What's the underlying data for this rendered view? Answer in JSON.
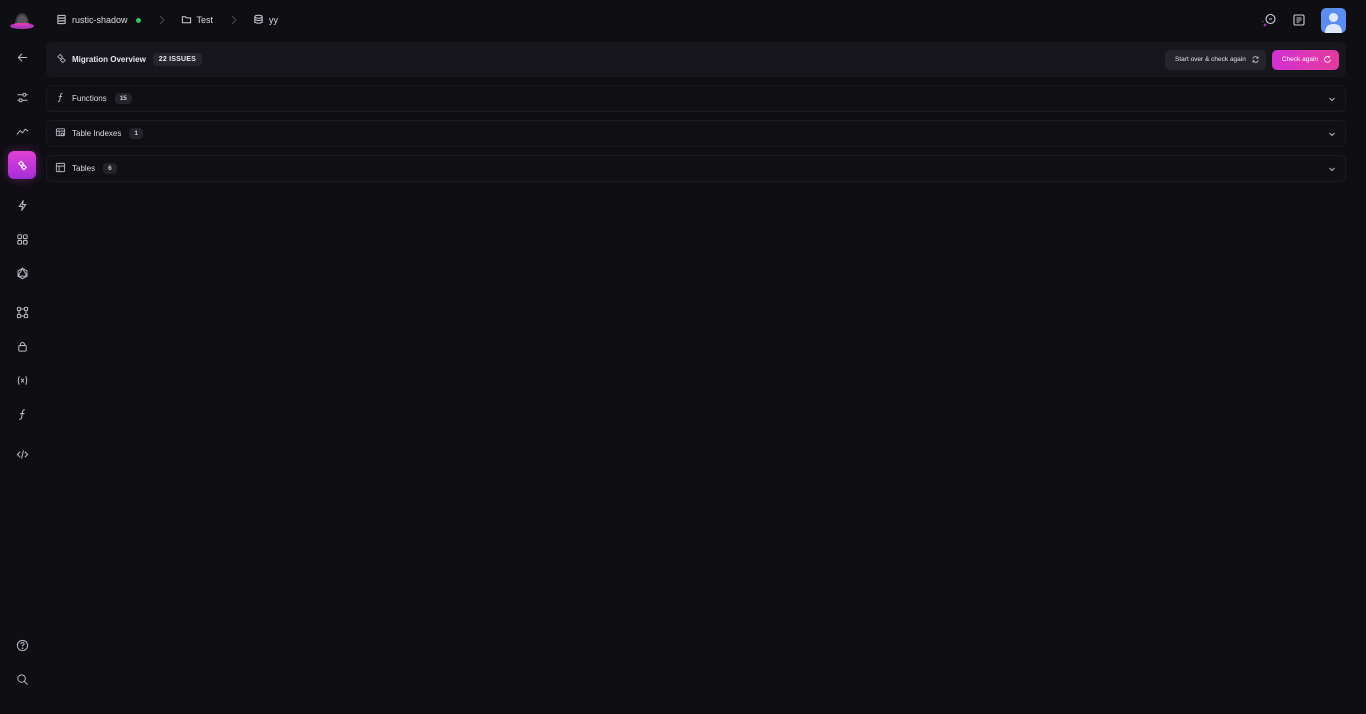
{
  "topbar": {
    "breadcrumb": [
      {
        "label": "rustic-shadow",
        "icon": "server-icon",
        "status_color": "#2fc35b"
      },
      {
        "label": "Test",
        "icon": "folder-icon"
      },
      {
        "label": "yy",
        "icon": "database-icon"
      }
    ]
  },
  "sidebar": {
    "items": [
      {
        "name": "back",
        "icon": "arrow-left-icon"
      },
      {
        "name": "settings",
        "icon": "sliders-icon"
      },
      {
        "name": "monitoring",
        "icon": "activity-icon"
      },
      {
        "name": "migration",
        "icon": "link-icon",
        "active": true
      },
      {
        "name": "events",
        "icon": "lightning-icon"
      },
      {
        "name": "dashboards",
        "icon": "grid-icon"
      },
      {
        "name": "graphql",
        "icon": "graphql-icon"
      },
      {
        "name": "modules",
        "icon": "nodes-icon"
      },
      {
        "name": "access",
        "icon": "lock-icon"
      },
      {
        "name": "params",
        "icon": "variable-icon"
      },
      {
        "name": "functions",
        "icon": "function-icon"
      },
      {
        "name": "api",
        "icon": "code-icon"
      },
      {
        "name": "help",
        "icon": "help-icon"
      },
      {
        "name": "search",
        "icon": "search-icon"
      }
    ]
  },
  "overview": {
    "title": "Migration Overview",
    "issues_badge": "22 ISSUES",
    "start_over_label": "Start over & check again",
    "check_again_label": "Check again"
  },
  "sections": [
    {
      "label": "Functions",
      "count": "15",
      "icon": "function-icon"
    },
    {
      "label": "Table Indexes",
      "count": "1",
      "icon": "table-index-icon"
    },
    {
      "label": "Tables",
      "count": "6",
      "icon": "table-icon"
    }
  ],
  "colors": {
    "accent": "#d431d2",
    "background": "#0f0e13",
    "status_online": "#2fc35b"
  }
}
